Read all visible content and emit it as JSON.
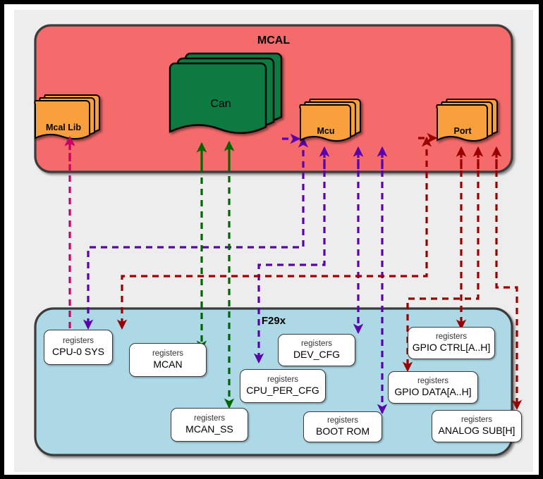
{
  "diagram": {
    "type": "block-diagram",
    "title_top": "MCAL",
    "title_bottom": "F29x",
    "colors": {
      "mcal_fill": "#F56B6B",
      "f29x_fill": "#ADD8E6",
      "module_fill": "#F9A03C",
      "can_fill": "#0E7A43",
      "canvas": "#EDEDED",
      "arrow_pink": "#CC0066",
      "arrow_purple": "#5B00B0",
      "arrow_green": "#006600",
      "arrow_darkred": "#9B0000",
      "box_border": "#3A3A3A",
      "frame_border": "#000000"
    }
  },
  "mcal": {
    "label": "MCAL",
    "modules": [
      {
        "id": "mcal-lib",
        "label": "Mcal Lib",
        "kind": "stack",
        "fill": "#F9A03C"
      },
      {
        "id": "can",
        "label": "Can",
        "kind": "stack",
        "fill": "#0E7A43"
      },
      {
        "id": "mcu",
        "label": "Mcu",
        "kind": "stack",
        "fill": "#F9A03C"
      },
      {
        "id": "port",
        "label": "Port",
        "kind": "stack",
        "fill": "#F9A03C"
      }
    ]
  },
  "f29x": {
    "label": "F29x",
    "registers": [
      {
        "id": "cpu0-sys",
        "top": "registers",
        "name": "CPU-0 SYS"
      },
      {
        "id": "mcan",
        "top": "registers",
        "name": "MCAN"
      },
      {
        "id": "mcan-ss",
        "top": "registers",
        "name": "MCAN_SS"
      },
      {
        "id": "cpu-per-cfg",
        "top": "registers",
        "name": "CPU_PER_CFG"
      },
      {
        "id": "dev-cfg",
        "top": "registers",
        "name": "DEV_CFG"
      },
      {
        "id": "boot-rom",
        "top": "registers",
        "name": "BOOT ROM"
      },
      {
        "id": "gpio-ctrl",
        "top": "registers",
        "name": "GPIO CTRL[A..H]"
      },
      {
        "id": "gpio-data",
        "top": "registers",
        "name": "GPIO DATA[A..H]"
      },
      {
        "id": "analog-sub",
        "top": "registers",
        "name": "ANALOG SUB[H]"
      }
    ]
  },
  "connections": [
    {
      "from": "cpu0-sys",
      "to": "mcal-lib",
      "color": "#CC0066",
      "style": "dashed"
    },
    {
      "from": "mcal-lib",
      "to": "cpu0-sys",
      "color": "#CC0066",
      "style": "dashed"
    },
    {
      "from": "mcan",
      "to": "can",
      "color": "#006600",
      "style": "dashed"
    },
    {
      "from": "mcan-ss",
      "to": "can",
      "color": "#006600",
      "style": "dashed"
    },
    {
      "from": "mcu",
      "to": "cpu0-sys",
      "color": "#5B00B0",
      "style": "dashed"
    },
    {
      "from": "mcu",
      "to": "cpu-per-cfg",
      "color": "#5B00B0",
      "style": "dashed"
    },
    {
      "from": "mcu",
      "to": "dev-cfg",
      "color": "#5B00B0",
      "style": "dashed"
    },
    {
      "from": "mcu",
      "to": "boot-rom",
      "color": "#5B00B0",
      "style": "dashed"
    },
    {
      "from": "port",
      "to": "cpu0-sys",
      "color": "#9B0000",
      "style": "dashed"
    },
    {
      "from": "port",
      "to": "gpio-ctrl",
      "color": "#9B0000",
      "style": "dashed"
    },
    {
      "from": "port",
      "to": "gpio-data",
      "color": "#9B0000",
      "style": "dashed"
    },
    {
      "from": "port",
      "to": "analog-sub",
      "color": "#9B0000",
      "style": "dashed"
    }
  ]
}
